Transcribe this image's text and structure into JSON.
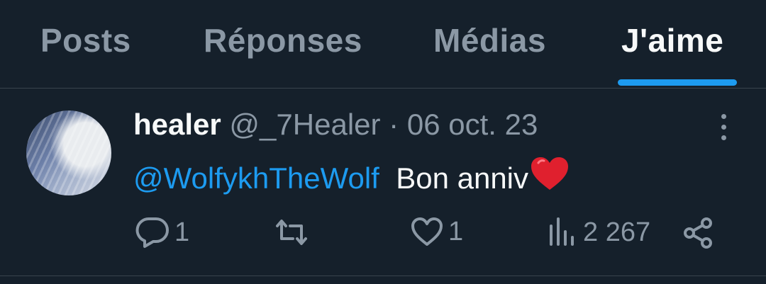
{
  "tabs": [
    {
      "label": "Posts",
      "active": false
    },
    {
      "label": "Réponses",
      "active": false
    },
    {
      "label": "Médias",
      "active": false
    },
    {
      "label": "J'aime",
      "active": true
    }
  ],
  "post": {
    "name": "healer",
    "handle": "@_7Healer",
    "separator": "·",
    "date": "06 oct. 23",
    "mention": "@WolfykhTheWolf",
    "text": "Bon anniv",
    "emoji_icon": "red-heart-emoji",
    "actions": {
      "replies": "1",
      "reposts": "",
      "likes": "1",
      "views": "2 267"
    }
  },
  "colors": {
    "background": "#15202b",
    "accent": "#1d9bf0",
    "muted": "#8b98a5",
    "text": "#f7f9f9",
    "divider": "#38444d"
  }
}
